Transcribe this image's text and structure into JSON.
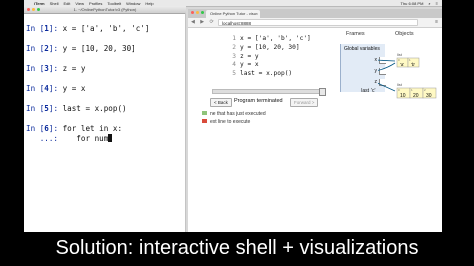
{
  "menubar": {
    "app_name": "iTerm",
    "items": [
      "Shell",
      "Edit",
      "View",
      "Profiles",
      "Toolbelt",
      "Window",
      "Help"
    ],
    "clock": "Thu 6:08 PM"
  },
  "terminal": {
    "title": "1. ~/OnlinePythonTutor/v3 (Python)",
    "lines": [
      {
        "num": "1",
        "code": "x = ['a', 'b', 'c']"
      },
      {
        "num": "2",
        "code": "y = [10, 20, 30]"
      },
      {
        "num": "3",
        "code": "z = y"
      },
      {
        "num": "4",
        "code": "y = x"
      },
      {
        "num": "5",
        "code": "last = x.pop()"
      },
      {
        "num": "6",
        "code": "for let in x:"
      }
    ],
    "continuation_prompt": "   ...:",
    "continuation_code": "    for num"
  },
  "browser": {
    "tab_title": "Online Python Tutor - visu",
    "tab_close": "×",
    "url": "localhost:8888",
    "nav": "◀ ▶ ⟳",
    "code_lines": [
      {
        "num": "1",
        "text": "x = ['a', 'b', 'c']"
      },
      {
        "num": "2",
        "text": "y = [10, 20, 30]"
      },
      {
        "num": "3",
        "text": "z = y"
      },
      {
        "num": "4",
        "text": "y = x"
      },
      {
        "num": "5",
        "text": "last = x.pop()"
      }
    ],
    "back_button": "< Back",
    "status": "Program terminated",
    "forward_button": "Forward >",
    "legend_executed": "ne that has just executed",
    "legend_next": "ext line to execute",
    "frames_header": "Frames",
    "objects_header": "Objects",
    "frame_title": "Global variables",
    "vars": [
      {
        "name": "x"
      },
      {
        "name": "y"
      },
      {
        "name": "z"
      },
      {
        "name": "last",
        "value": "'c'"
      }
    ],
    "list1": {
      "label": "list",
      "indices": [
        "0",
        "1"
      ],
      "values": [
        "'a'",
        "'b'"
      ]
    },
    "list2": {
      "label": "list",
      "indices": [
        "0",
        "1",
        "2"
      ],
      "values": [
        "10",
        "20",
        "30"
      ]
    }
  },
  "caption": "Solution: interactive shell + visualizations",
  "colors": {
    "prompt": "#0a2a9c",
    "frame_bg": "#e2ebf6",
    "list_bg": "#fff9c4",
    "arrow": "#005583"
  }
}
